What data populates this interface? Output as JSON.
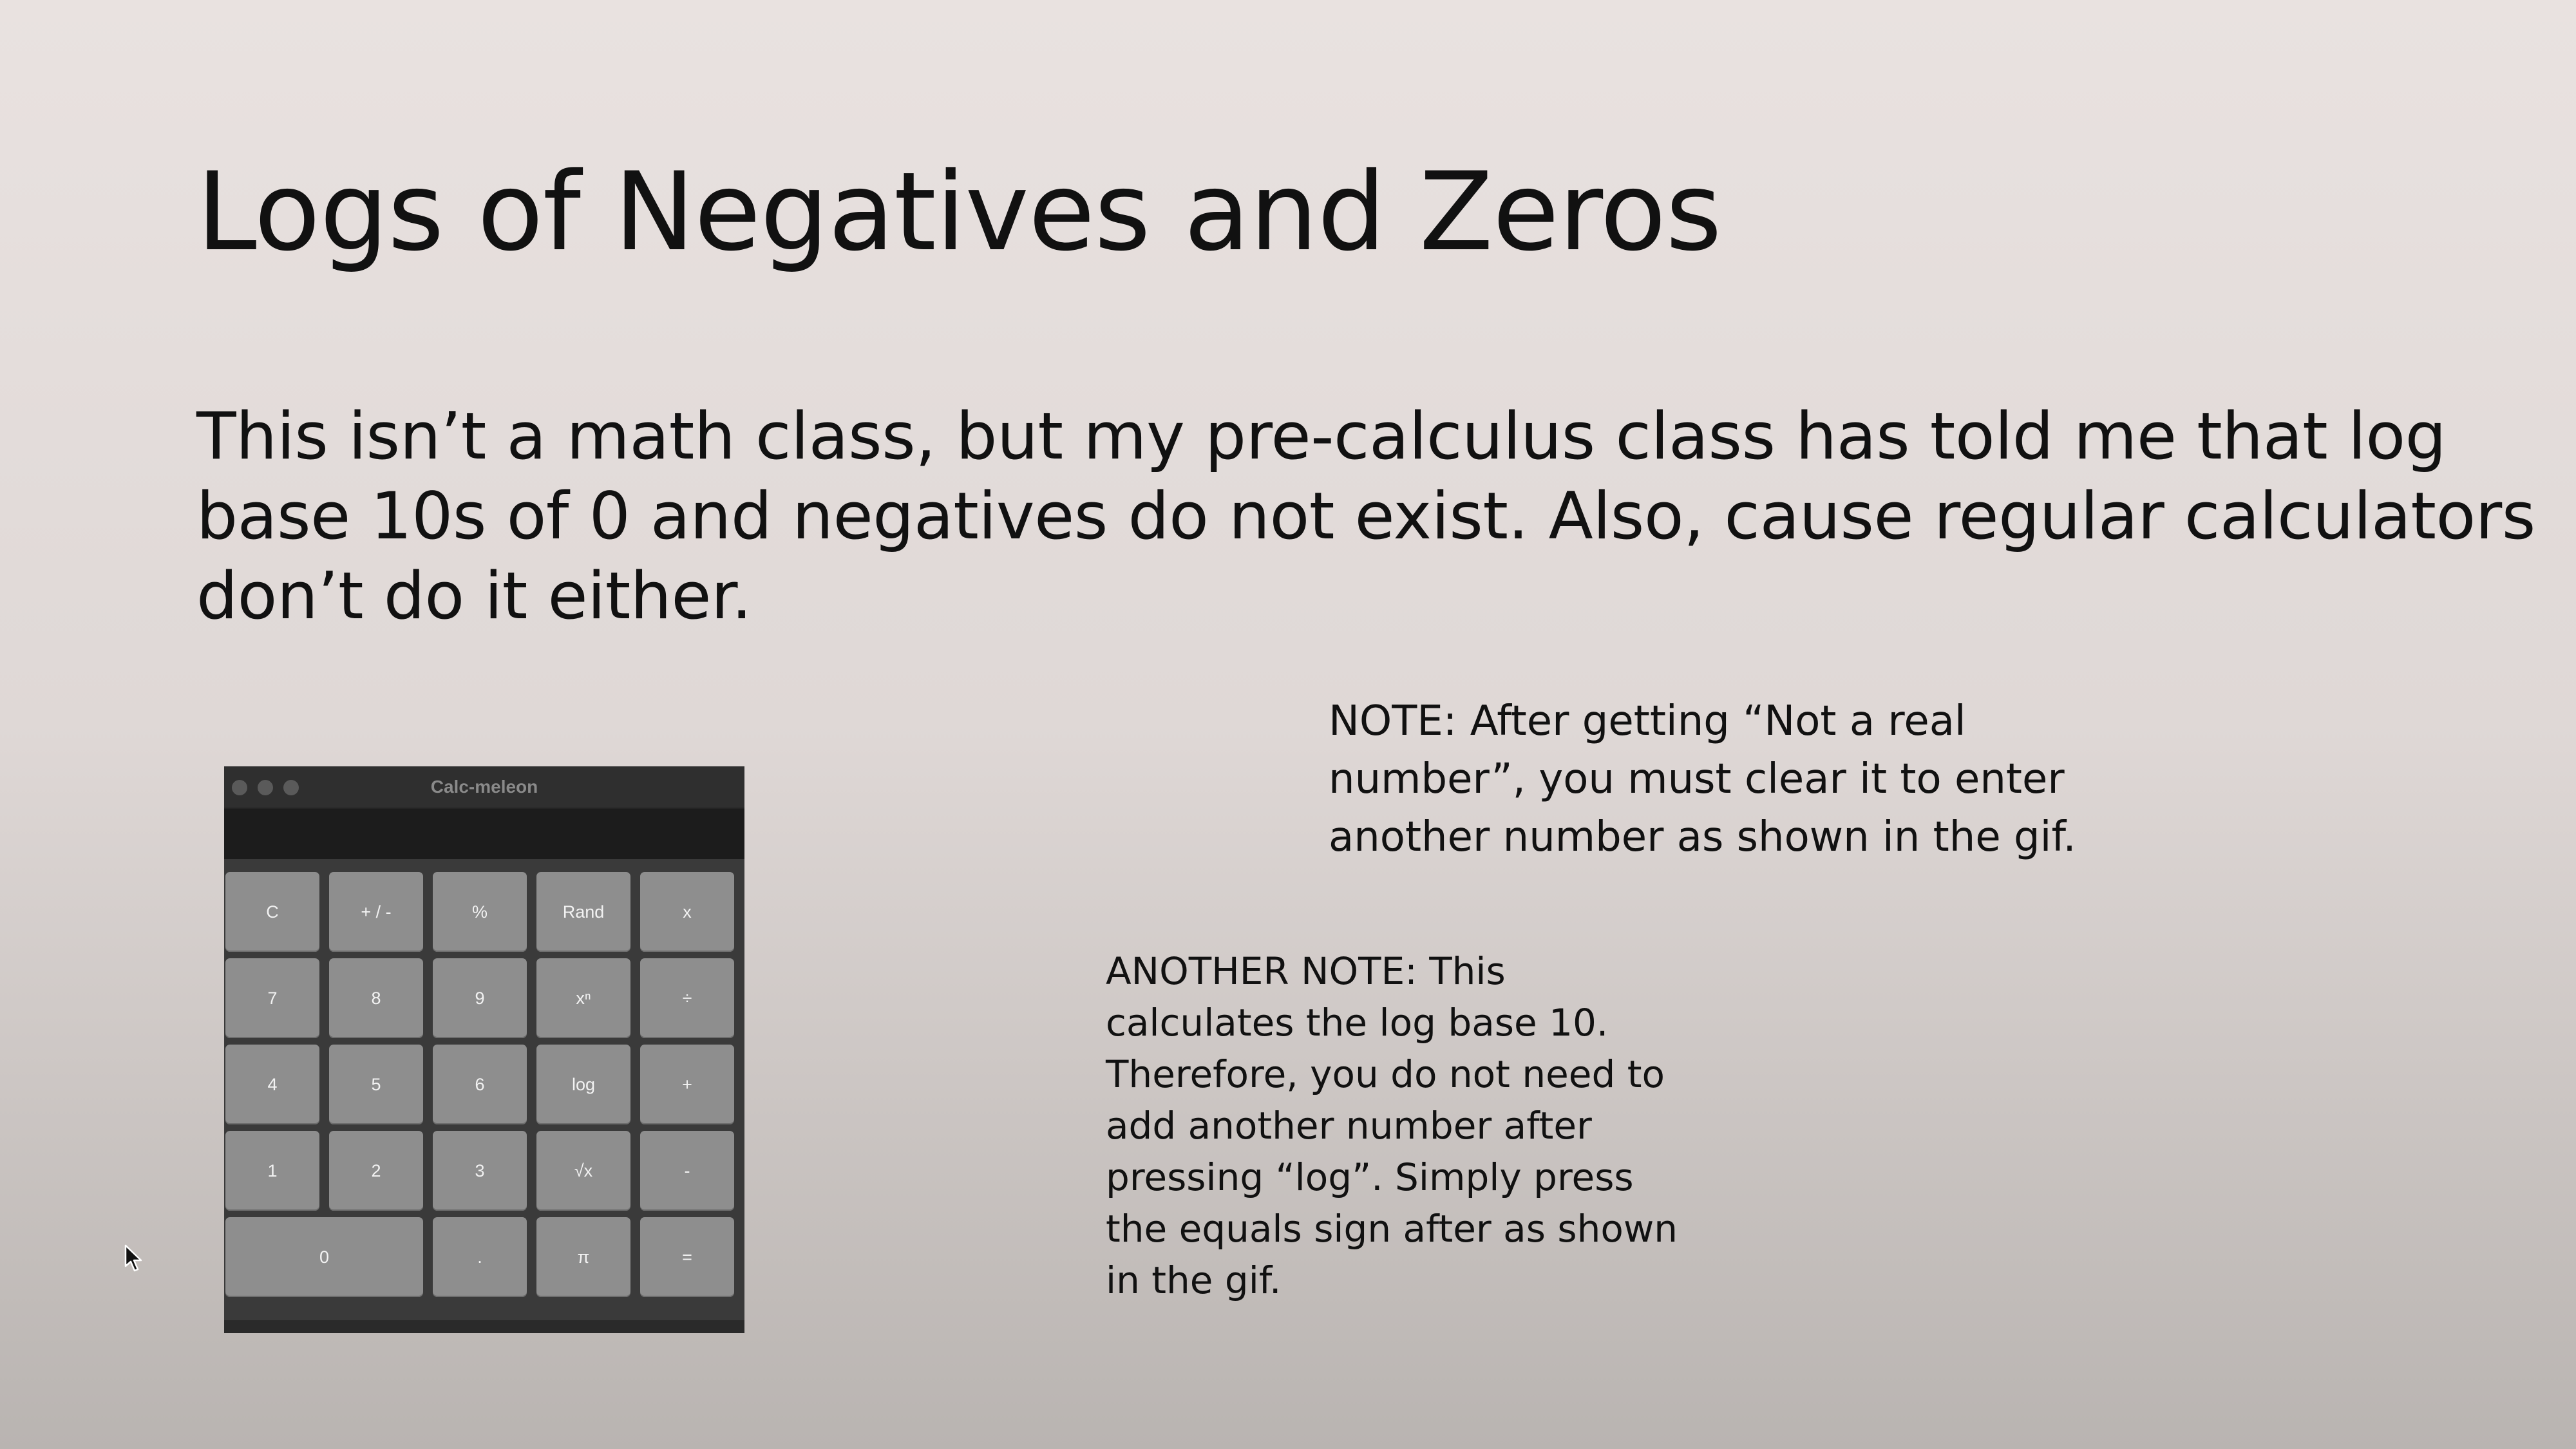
{
  "slide": {
    "title": "Logs of Negatives and Zeros",
    "body_lines": [
      "This isn’t a math class, but my pre-calculus class has told me that log",
      "base 10s of 0 and negatives do not exist. Also, cause regular calculators",
      "don’t do it either."
    ],
    "note1_lines": [
      "NOTE: After getting “Not a real",
      "number”, you must clear it to enter",
      "another number as shown in the gif."
    ],
    "note2_lines": [
      "ANOTHER NOTE: This",
      "calculates the log base 10.",
      "Therefore, you do not need to",
      "add another number after",
      "pressing “log”. Simply press",
      "the equals sign after as shown",
      "in the gif."
    ]
  },
  "calculator": {
    "window_title": "Calc-meleon",
    "display_value": "",
    "keys": {
      "clear": "C",
      "negate": "+ / -",
      "percent": "%",
      "rand": "Rand",
      "multiply": "x",
      "seven": "7",
      "eight": "8",
      "nine": "9",
      "power": "xⁿ",
      "divide": "÷",
      "four": "4",
      "five": "5",
      "six": "6",
      "log": "log",
      "plus": "+",
      "one": "1",
      "two": "2",
      "three": "3",
      "sqrt": "√x",
      "minus": "-",
      "zero": "0",
      "decimal": ".",
      "pi": "π",
      "equals": "="
    },
    "colors": {
      "window_bg": "#3a3a3a",
      "key_bg": "#8e8e8e",
      "display_bg": "#1c1c1c"
    }
  },
  "icons": {
    "cursor": "mouse-pointer-icon"
  }
}
